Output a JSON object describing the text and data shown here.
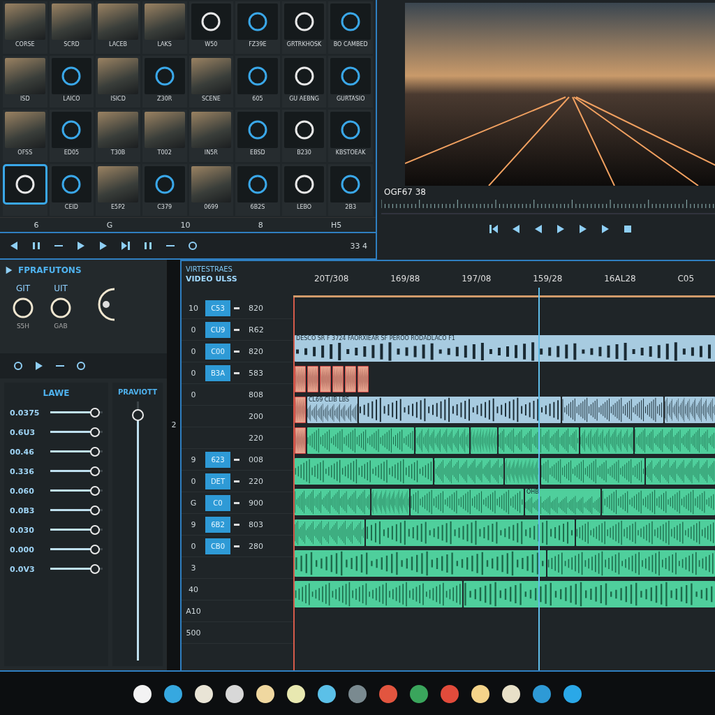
{
  "media_bin": {
    "items": [
      {
        "kind": "photo",
        "label": "CORSE",
        "selected": false
      },
      {
        "kind": "photo",
        "label": "SCRD",
        "selected": false
      },
      {
        "kind": "photo",
        "label": "LACEB",
        "selected": false
      },
      {
        "kind": "photo",
        "label": "LAKS",
        "selected": false
      },
      {
        "kind": "icon",
        "label": "W50",
        "selected": false
      },
      {
        "kind": "icon",
        "label": "FZ39E",
        "selected": false
      },
      {
        "kind": "icon",
        "label": "GRTRKHOSK",
        "selected": false
      },
      {
        "kind": "icon",
        "label": "BO CAMBED",
        "selected": false
      },
      {
        "kind": "photo",
        "label": "ISD",
        "selected": false
      },
      {
        "kind": "icon",
        "label": "LAICO",
        "selected": false
      },
      {
        "kind": "photo",
        "label": "ISICD",
        "selected": false
      },
      {
        "kind": "icon",
        "label": "Z30R",
        "selected": false
      },
      {
        "kind": "photo",
        "label": "SCENE",
        "selected": false
      },
      {
        "kind": "icon",
        "label": "605",
        "selected": false
      },
      {
        "kind": "icon",
        "label": "GU AEBNG",
        "selected": false
      },
      {
        "kind": "icon",
        "label": "GURTASIO",
        "selected": false
      },
      {
        "kind": "photo",
        "label": "OFSS",
        "selected": false
      },
      {
        "kind": "icon",
        "label": "ED05",
        "selected": false
      },
      {
        "kind": "photo",
        "label": "T30B",
        "selected": false
      },
      {
        "kind": "photo",
        "label": "T002",
        "selected": false
      },
      {
        "kind": "photo",
        "label": "IN5R",
        "selected": false
      },
      {
        "kind": "icon",
        "label": "EBSD",
        "selected": false
      },
      {
        "kind": "icon",
        "label": "B230",
        "selected": false
      },
      {
        "kind": "icon",
        "label": "KBSTOEAK",
        "selected": false
      },
      {
        "kind": "icon",
        "selected": true
      },
      {
        "kind": "icon",
        "label": "CEID",
        "selected": false
      },
      {
        "kind": "photo",
        "label": "E5P2",
        "selected": false
      },
      {
        "kind": "icon",
        "label": "C379",
        "selected": false
      },
      {
        "kind": "photo",
        "label": "0699",
        "selected": false
      },
      {
        "kind": "icon",
        "label": "6B2S",
        "selected": false
      },
      {
        "kind": "icon",
        "label": "LEBO",
        "selected": false
      },
      {
        "kind": "icon",
        "label": "2B3",
        "selected": false
      }
    ],
    "pager": [
      "6",
      "G",
      "10",
      "8",
      "H5"
    ],
    "counter": "33 4"
  },
  "viewer": {
    "timecode": "OGF67 38"
  },
  "effects": {
    "title": "FPRAFUTONS",
    "knobs": [
      {
        "label": "GIT",
        "value": "S5H"
      },
      {
        "label": "UIT",
        "value": "GAB"
      }
    ],
    "levels_title": "LAWE",
    "sliders": [
      {
        "label": "0.0375",
        "level": 0.95
      },
      {
        "label": "0.6U3",
        "level": 0.95
      },
      {
        "label": "00.46",
        "level": 0.95
      },
      {
        "label": "0.336",
        "level": 0.95
      },
      {
        "label": "0.060",
        "level": 0.95
      },
      {
        "label": "0.0B3",
        "level": 0.95
      },
      {
        "label": "0.030",
        "level": 0.95
      },
      {
        "label": "0.000",
        "level": 0.95
      },
      {
        "label": "0.0V3",
        "level": 0.95
      }
    ],
    "preview": {
      "title": "PRAVIOTT",
      "level": 0.97
    },
    "strip_label": "2"
  },
  "timeline": {
    "title": "VIRTESTRAES",
    "subtitle": "VIDEO ULSS",
    "ruler": [
      "20T/308",
      "169/88",
      "197/08",
      "159/28",
      "16AL28",
      "C05"
    ],
    "tracks": [
      {
        "number": "10",
        "tag": "C53",
        "value": "820"
      },
      {
        "number": "0",
        "tag": "CU9",
        "value": "R62"
      },
      {
        "number": "0",
        "tag": "C00",
        "value": "820"
      },
      {
        "number": "0",
        "tag": "B3A",
        "value": "583"
      },
      {
        "number": "0",
        "value": "808"
      },
      {
        "value": "200"
      },
      {
        "value": "220"
      },
      {
        "number": "9",
        "tag": "623",
        "value": "008"
      },
      {
        "number": "0",
        "tag": "DET",
        "value": "220"
      },
      {
        "number": "G",
        "tag": "C0",
        "value": "900"
      },
      {
        "number": "9",
        "tag": "6B2",
        "value": "803"
      },
      {
        "number": "0",
        "tag": "CB0",
        "value": "280"
      },
      {
        "number": "3"
      },
      {
        "number": "40"
      },
      {
        "number": "A10"
      },
      {
        "number": "500"
      }
    ],
    "lanes": [
      {
        "clips": [
          {
            "kind": "audio",
            "label": "DESCO SR F 3724 FAORXIEAR SF PEROO RODADLACO F1"
          }
        ]
      },
      {
        "clips": [
          {
            "kind": "marker"
          },
          {
            "kind": "marker"
          },
          {
            "kind": "marker"
          },
          {
            "kind": "marker"
          },
          {
            "kind": "marker"
          },
          {
            "kind": "marker"
          }
        ]
      },
      {
        "clips": [
          {
            "kind": "marker"
          },
          {
            "kind": "audio",
            "label": "CL69 CLIB LBS"
          },
          {
            "kind": "audio"
          },
          {
            "kind": "audio"
          },
          {
            "kind": "audio"
          }
        ]
      },
      {
        "clips": [
          {
            "kind": "marker"
          },
          {
            "kind": "video"
          },
          {
            "kind": "video"
          },
          {
            "kind": "video"
          },
          {
            "kind": "video"
          },
          {
            "kind": "video"
          },
          {
            "kind": "video"
          }
        ]
      },
      {
        "clips": [
          {
            "kind": "video"
          },
          {
            "kind": "video"
          },
          {
            "kind": "video"
          },
          {
            "kind": "video"
          },
          {
            "kind": "video"
          }
        ]
      },
      {
        "clips": [
          {
            "kind": "video"
          },
          {
            "kind": "video"
          },
          {
            "kind": "video"
          },
          {
            "kind": "video",
            "label": "OHB"
          },
          {
            "kind": "video"
          }
        ]
      },
      {
        "clips": [
          {
            "kind": "video"
          },
          {
            "kind": "video"
          },
          {
            "kind": "video"
          }
        ]
      },
      {
        "clips": [
          {
            "kind": "video"
          },
          {
            "kind": "video"
          }
        ]
      },
      {
        "clips": [
          {
            "kind": "video"
          },
          {
            "kind": "video"
          }
        ]
      }
    ]
  }
}
